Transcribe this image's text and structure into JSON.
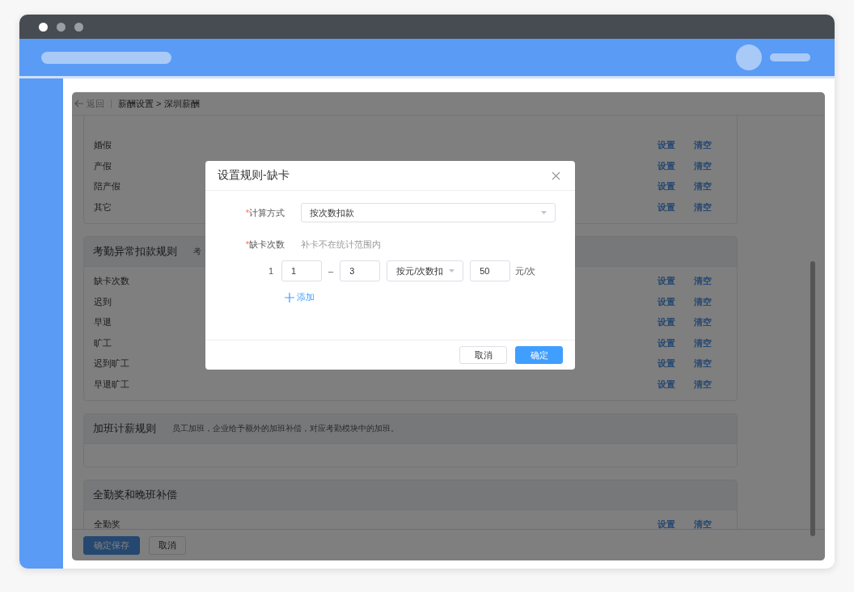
{
  "breadcrumb": {
    "back": "返回",
    "path": "薪酬设置 > 深圳薪酬"
  },
  "sections": [
    {
      "rows": [
        {
          "label": "婚假",
          "actions": [
            "设置",
            "清空"
          ]
        },
        {
          "label": "产假",
          "actions": [
            "设置",
            "清空"
          ]
        },
        {
          "label": "陪产假",
          "actions": [
            "设置",
            "清空"
          ]
        },
        {
          "label": "其它",
          "actions": [
            "设置",
            "清空"
          ]
        }
      ]
    },
    {
      "title": "考勤异常扣款规则",
      "description": "考",
      "rows": [
        {
          "label": "缺卡次数",
          "actions": [
            "设置",
            "清空"
          ]
        },
        {
          "label": "迟到",
          "actions": [
            "设置",
            "清空"
          ]
        },
        {
          "label": "早退",
          "actions": [
            "设置",
            "清空"
          ]
        },
        {
          "label": "旷工",
          "actions": [
            "设置",
            "清空"
          ]
        },
        {
          "label": "迟到旷工",
          "actions": [
            "设置",
            "清空"
          ]
        },
        {
          "label": "早退旷工",
          "actions": [
            "设置",
            "清空"
          ]
        }
      ]
    },
    {
      "title": "加班计薪规则",
      "description": "员工加班，企业给予额外的加班补偿，对应考勤模块中的加班。"
    },
    {
      "title": "全勤奖和晚班补偿",
      "rows": [
        {
          "label": "全勤奖",
          "actions": [
            "设置",
            "清空"
          ]
        }
      ]
    }
  ],
  "footer_buttons": [
    {
      "label": "确定保存",
      "kind": "primary"
    },
    {
      "label": "取消",
      "kind": "default"
    }
  ],
  "dialog": {
    "title": "设置规则-缺卡",
    "method": {
      "label": "计算方式",
      "required_mark": "*",
      "value": "按次数扣款"
    },
    "count": {
      "label": "缺卡次数",
      "required_mark": "*",
      "hint": "补卡不在统计范围内"
    },
    "tiers": [
      {
        "index": "1",
        "from": "1",
        "separator": "–",
        "to": "3",
        "mode": "按元/次数扣",
        "amount": "50",
        "unit": "元/次"
      }
    ],
    "add_label": "添加",
    "buttons": [
      {
        "label": "取消",
        "kind": "default"
      },
      {
        "label": "确定",
        "kind": "primary"
      }
    ]
  }
}
